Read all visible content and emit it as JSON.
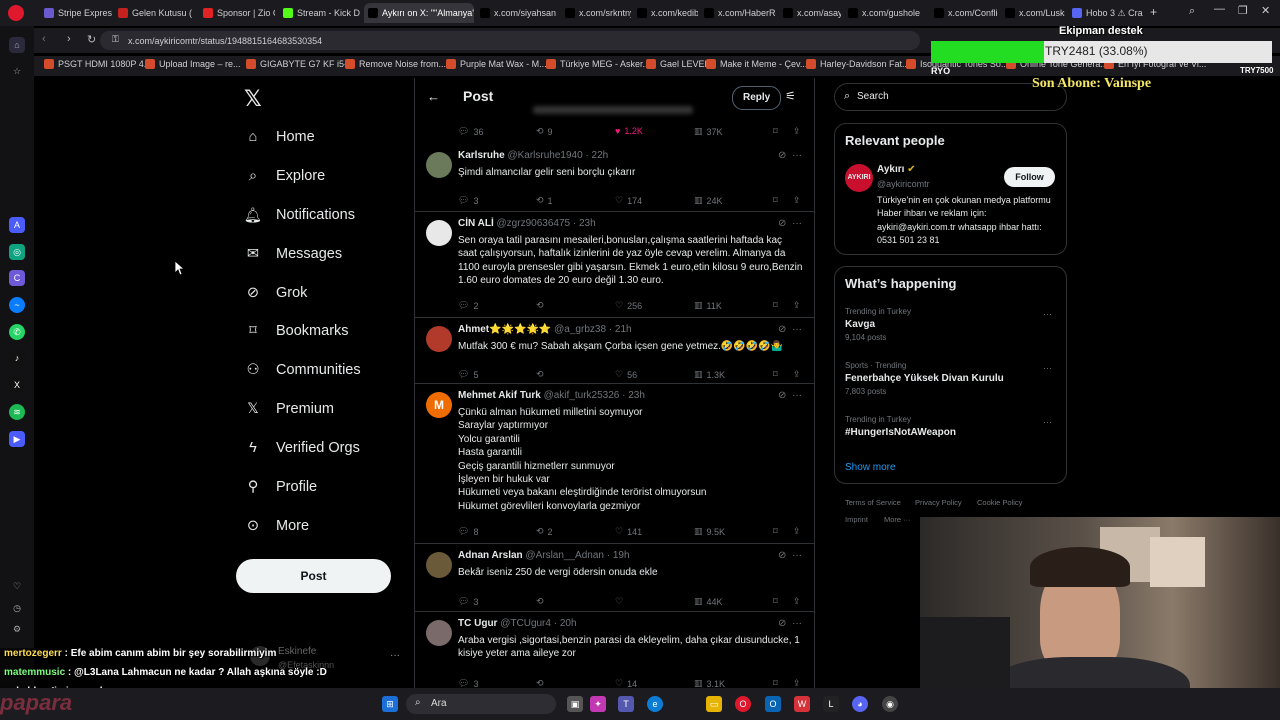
{
  "browser": {
    "tabs": [
      {
        "label": "Stripe Express",
        "color": "#6a5acd"
      },
      {
        "label": "Gelen Kutusu (",
        "color": "#c5221f"
      },
      {
        "label": "Sponsor | Zio C",
        "color": "#e02424"
      },
      {
        "label": "Stream - Kick D",
        "color": "#53fc18"
      },
      {
        "label": "Aykırı on X: \"\"Almanya'da",
        "color": "#000000"
      },
      {
        "label": "x.com/siyahsan",
        "color": "#000000"
      },
      {
        "label": "x.com/srkntnyi",
        "color": "#000000"
      },
      {
        "label": "x.com/kedibek",
        "color": "#000000"
      },
      {
        "label": "x.com/HaberRe",
        "color": "#000000"
      },
      {
        "label": "x.com/asayisbe",
        "color": "#000000"
      },
      {
        "label": "x.com/gushole",
        "color": "#000000"
      },
      {
        "label": "x.com/Conflict",
        "color": "#000000"
      },
      {
        "label": "x.com/Lusko01",
        "color": "#000000"
      },
      {
        "label": "Hobo 3 ⚠ Cra",
        "color": "#5865f2"
      }
    ],
    "url": "x.com/aykiricomtr/status/1948815164683530354",
    "bookmarks": [
      "PSGT HDMI 1080P 4...",
      "Upload Image – re...",
      "GIGABYTE G7 KF i5-...",
      "Remove Noise from...",
      "Purple Mat Wax - M...",
      "Türkiye MEG - Asker...",
      "Gael LEVEL",
      "Make it Meme - Çev...",
      "Harley-Davidson Fat...",
      "Isoquantic Tones So...",
      "Online Tone Genera...",
      "En İyi Fotoğraf ve Vi..."
    ]
  },
  "nav": {
    "items": [
      "Home",
      "Explore",
      "Notifications",
      "Messages",
      "Grok",
      "Bookmarks",
      "Communities",
      "Premium",
      "Verified Orgs",
      "Profile",
      "More"
    ],
    "post_button": "Post"
  },
  "header": {
    "title": "Post",
    "reply_button": "Reply"
  },
  "top_stats": {
    "replies": "36",
    "reposts": "9",
    "likes": "1.2K",
    "views": "37K"
  },
  "tweets": [
    {
      "name": "Karlsruhe",
      "handle": "@Karlsruhe1940 · 22h",
      "text": "Şimdi almancılar gelir seni borçlu çıkarır",
      "replies": "3",
      "reposts": "1",
      "likes": "174",
      "views": "24K",
      "avatar": "#6b7a5a"
    },
    {
      "name": "CİN ALİ",
      "handle": "@zgrz90636475 · 23h",
      "text": "Sen oraya  tatil parasını mesaileri,bonusları,çalışma saatlerini haftada kaç saat çalışıyorsun, haftalık izinlerini de yaz öyle cevap verelim. Almanya da 1100 euroyla prensesler gibi yaşarsın. Ekmek 1 euro,etin kilosu 9 euro,Benzin 1.60 euro domates de 20 euro değil 1.30 euro.",
      "replies": "2",
      "reposts": "",
      "likes": "256",
      "views": "11K",
      "avatar": "#e8e8e8"
    },
    {
      "name": "Ahmet⭐🌟⭐🌟⭐",
      "handle": "@a_grbz38 · 21h",
      "text": "Mutfak 300 € mu? Sabah akşam Çorba içsen gene yetmez.🤣🤣🤣🤣🤷‍♂️",
      "replies": "5",
      "reposts": "",
      "likes": "56",
      "views": "1.3K",
      "avatar": "#b23a2a"
    },
    {
      "name": "Mehmet Akif Turk",
      "handle": "@akif_turk25326 · 23h",
      "text": "Çünkü  alman hükumeti milletini soymuyor\nSaraylar yaptırmıyor\nYolcu garantili\nHasta garantili\nGeçiş garantili  hizmetlerr  sunmuyor\nİşleyen bir hukuk var\nHükumeti veya bakanı eleştirdiğinde terörist olmuyorsun\nHükumet görevlileri konvoylarla gezmiyor",
      "replies": "8",
      "reposts": "2",
      "likes": "141",
      "views": "9.5K",
      "avatar": "#ef6c00",
      "avatar_letter": "M"
    },
    {
      "name": "Adnan Arslan",
      "handle": "@Arslan__Adnan · 19h",
      "text": "Bekâr iseniz 250 de vergi ödersin onuda ekle",
      "replies": "3",
      "reposts": "",
      "likes": "",
      "views": "44K",
      "avatar": "#6a5a3a"
    },
    {
      "name": "TC Ugur",
      "handle": "@TCUgur4 · 20h",
      "text": "Araba vergisi ,sigortasi,benzin parasi da ekleyelim, daha çıkar dusunducke, 1 kisiye yeter ama aileye zor",
      "replies": "3",
      "reposts": "",
      "likes": "14",
      "views": "3.1K",
      "avatar": "#7a6a6a"
    }
  ],
  "right": {
    "search_placeholder": "Search",
    "relevant_title": "Relevant people",
    "person": {
      "name": "Aykırı",
      "handle": "@aykiricomtr",
      "follow": "Follow",
      "bio": "Türkiye'nin en çok okunan medya platformu Haber ihbarı ve reklam için: aykiri@aykiri.com.tr whatsapp ihbar hattı: 0531 501 23 81"
    },
    "happening_title": "What’s happening",
    "trends": [
      {
        "meta": "Trending in Turkey",
        "title": "Kavga",
        "count": "9,104 posts"
      },
      {
        "meta": "Sports · Trending",
        "title": "Fenerbahçe Yüksek Divan Kurulu",
        "count": "7,803 posts"
      },
      {
        "meta": "Trending in Turkey",
        "title": "#HungerIsNotAWeapon",
        "count": ""
      }
    ],
    "show_more": "Show more",
    "footer": [
      "Terms of Service",
      "Privacy Policy",
      "Cookie Policy",
      "Imprint",
      "More ···"
    ]
  },
  "overlay": {
    "donation_title": "Ekipman destek",
    "donation_text": "TRY2481 (33.08%)",
    "donation_progress": 0.3308,
    "donation_left": "RYO",
    "donation_right": "TRY7500",
    "last_sub": "Son Abone: Vainspe",
    "chat": [
      {
        "user": "mertozegerr",
        "msg": " : Efe abim canım abim bir şey sorabilirmiyim",
        "color": "#ffdd55"
      },
      {
        "user": "matemmusic",
        "msg": " : @L3Lana Lahmacun ne kadar ? Allah aşkına söyle :D",
        "color": "#7cfc7c"
      },
      {
        "user": "",
        "msg": "n de blerp'imiz var abanssss",
        "color": "#ffffff"
      },
      {
        "user": "",
        "msg": "zinefe",
        "color": "#ffffff"
      }
    ],
    "ghost_name": "Eskinefe",
    "ghost_handle": "@Efetaskinnn"
  },
  "taskbar": {
    "search_label": "Ara"
  }
}
